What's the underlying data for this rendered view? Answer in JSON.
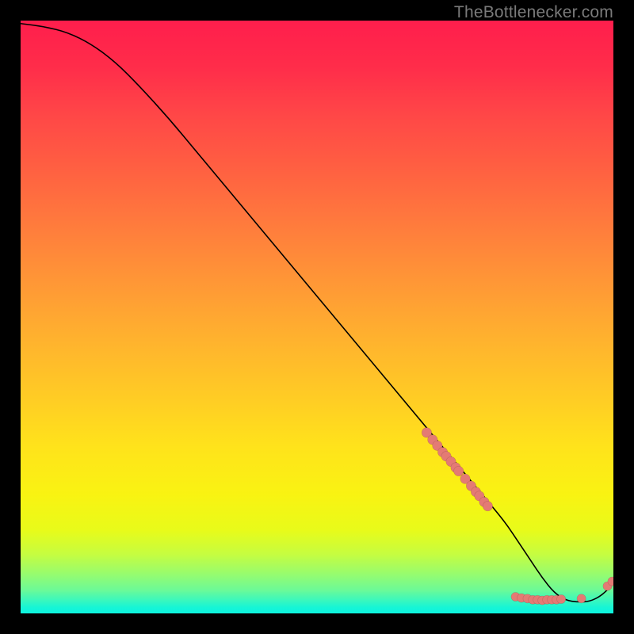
{
  "attribution": "TheBottlenecker.com",
  "colors": {
    "dot": "#e47a74",
    "curve": "#000000",
    "background": "#000000"
  },
  "chart_data": {
    "type": "line",
    "title": "",
    "xlabel": "",
    "ylabel": "",
    "xlim": [
      0,
      100
    ],
    "ylim": [
      0,
      100
    ],
    "series": [
      {
        "name": "curve",
        "x": [
          0,
          4,
          8,
          12,
          16,
          20,
          25,
          30,
          35,
          40,
          45,
          50,
          55,
          60,
          65,
          70,
          75,
          80,
          82,
          84,
          86,
          88,
          90,
          92,
          94,
          96,
          98,
          100
        ],
        "y": [
          99.5,
          99,
          98,
          96,
          93,
          89,
          83.5,
          77.5,
          71.5,
          65.5,
          59.5,
          53.5,
          47.5,
          41.5,
          35.5,
          29.5,
          23.5,
          17.5,
          15,
          12,
          9,
          6,
          3.5,
          2.2,
          1.9,
          2.0,
          3.0,
          5.0
        ]
      }
    ],
    "annotations": {
      "dots_cluster_upper": [
        {
          "x": 68.5,
          "y": 30.5
        },
        {
          "x": 69.5,
          "y": 29.3
        },
        {
          "x": 70.3,
          "y": 28.3
        },
        {
          "x": 71.2,
          "y": 27.2
        },
        {
          "x": 71.8,
          "y": 26.5
        },
        {
          "x": 72.6,
          "y": 25.6
        },
        {
          "x": 73.4,
          "y": 24.6
        },
        {
          "x": 73.9,
          "y": 24.0
        },
        {
          "x": 75.0,
          "y": 22.7
        },
        {
          "x": 76.0,
          "y": 21.5
        },
        {
          "x": 76.8,
          "y": 20.5
        },
        {
          "x": 77.4,
          "y": 19.8
        },
        {
          "x": 78.2,
          "y": 18.8
        },
        {
          "x": 78.8,
          "y": 18.1
        }
      ],
      "dots_cluster_lower": [
        {
          "x": 83.5,
          "y": 2.8
        },
        {
          "x": 84.5,
          "y": 2.6
        },
        {
          "x": 85.5,
          "y": 2.5
        },
        {
          "x": 86.4,
          "y": 2.3
        },
        {
          "x": 87.2,
          "y": 2.3
        },
        {
          "x": 88.0,
          "y": 2.2
        },
        {
          "x": 88.8,
          "y": 2.3
        },
        {
          "x": 89.6,
          "y": 2.3
        },
        {
          "x": 90.4,
          "y": 2.3
        },
        {
          "x": 91.2,
          "y": 2.4
        },
        {
          "x": 94.6,
          "y": 2.5
        },
        {
          "x": 99.0,
          "y": 4.6
        },
        {
          "x": 99.8,
          "y": 5.4
        }
      ]
    }
  }
}
